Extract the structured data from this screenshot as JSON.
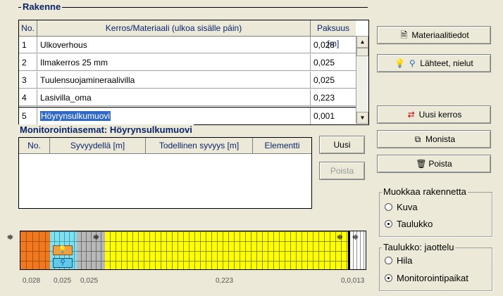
{
  "rakenne": {
    "title": "Rakenne",
    "columns": [
      "No.",
      "Kerros/Materiaali (ulkoa sisälle päin)",
      "Paksuus [m]"
    ],
    "rows": [
      {
        "no": "1",
        "material": "Ulkoverhous",
        "thickness": "0,028"
      },
      {
        "no": "2",
        "material": "Ilmakerros 25 mm",
        "thickness": "0,025"
      },
      {
        "no": "3",
        "material": "Tuulensuojamineraalivilla",
        "thickness": "0,025"
      },
      {
        "no": "4",
        "material": "Lasivilla_oma",
        "thickness": "0,223"
      },
      {
        "no": "5",
        "material": "Höyrynsulkumuovi",
        "thickness": "0,001"
      }
    ]
  },
  "monitor": {
    "title": "Monitorointiasemat: Höyrynsulkumuovi",
    "columns": [
      "No.",
      "Syvyydellä [m]",
      "Todellinen syvyys [m]",
      "Elementti"
    ],
    "new_label": "Uusi",
    "delete_label": "Poista"
  },
  "buttons": {
    "materials": "Materiaalitiedot",
    "sources": "Lähteet, nielut",
    "new_layer": "Uusi kerros",
    "duplicate": "Monista",
    "delete": "Poista"
  },
  "edit_group": {
    "title": "Muokkaa rakennetta",
    "options": [
      "Kuva",
      "Taulukko"
    ],
    "selected": "Taulukko"
  },
  "table_group": {
    "title": "Taulukko: jaottelu",
    "options": [
      "Hila",
      "Monitorointipaikat"
    ],
    "selected": "Monitorointipaikat"
  },
  "scale": {
    "labels": [
      "0,028",
      "0,025",
      "0,025",
      "0,223",
      "0,0,013"
    ]
  },
  "colors": {
    "layer1": "#f07820",
    "layer2": "#80e0f0",
    "layer3": "#b8b8b8",
    "layer4": "#ffff00",
    "layer5": "#000000"
  }
}
